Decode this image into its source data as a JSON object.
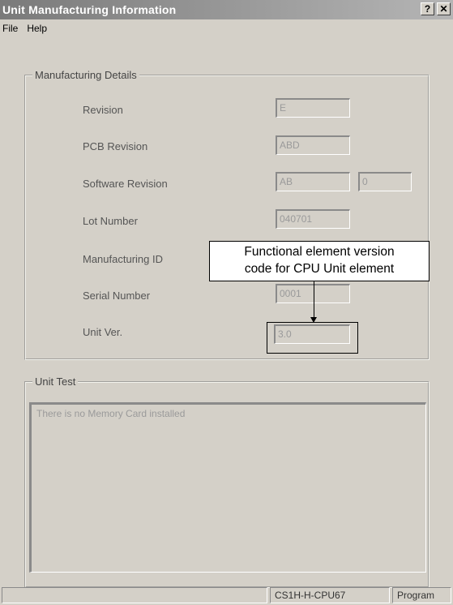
{
  "window": {
    "title": "Unit Manufacturing Information",
    "help_button": "?",
    "close_button": "✕"
  },
  "menu": [
    {
      "label": "File"
    },
    {
      "label": "Help"
    }
  ],
  "details": {
    "legend": "Manufacturing Details",
    "rows": {
      "revision": {
        "label": "Revision",
        "value": "E"
      },
      "pcb_revision": {
        "label": "PCB Revision",
        "value": "ABD"
      },
      "software_revision": {
        "label": "Software Revision",
        "value": "AB",
        "value2": "0"
      },
      "lot_number": {
        "label": "Lot Number",
        "value": "040701"
      },
      "manufacturing_id": {
        "label": "Manufacturing ID"
      },
      "serial_number": {
        "label": "Serial Number",
        "value": "0001"
      },
      "unit_ver": {
        "label": "Unit Ver.",
        "value": "3.0"
      }
    }
  },
  "unit_test": {
    "legend": "Unit Test",
    "message": "There is no Memory Card installed"
  },
  "annotation": {
    "line1": "Functional element version",
    "line2": "code for CPU Unit element"
  },
  "status": {
    "model": "CS1H-H-CPU67",
    "mode": "Program"
  }
}
